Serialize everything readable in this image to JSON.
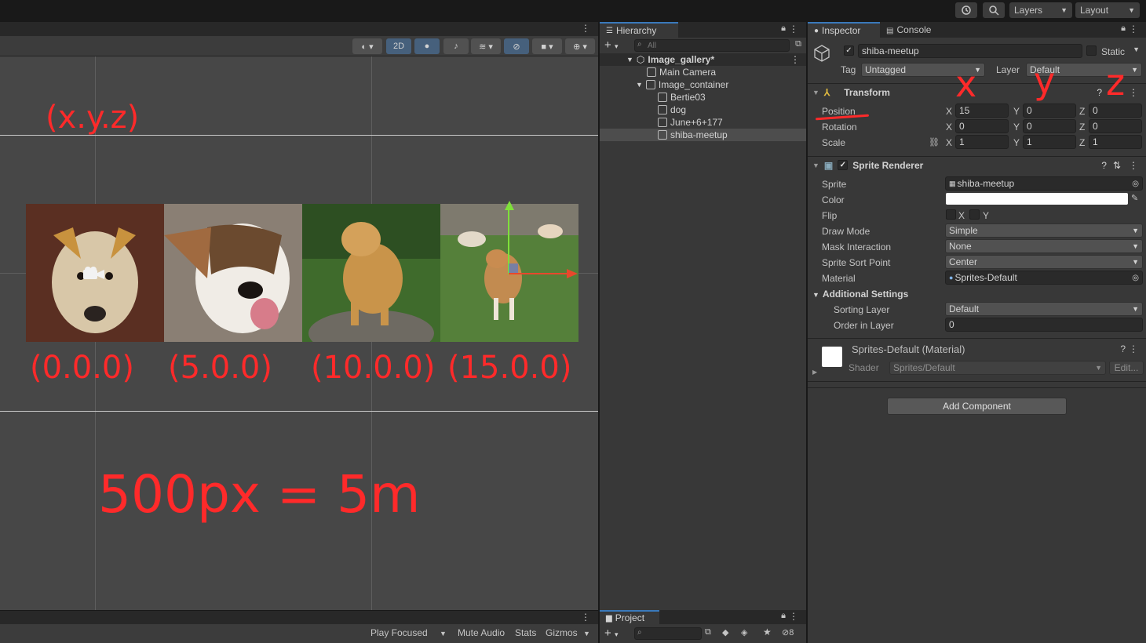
{
  "topbar": {
    "layers_label": "Layers",
    "layout_label": "Layout",
    "history_icon": "history-icon",
    "search_icon": "search-icon"
  },
  "scene": {
    "toolbar": {
      "mode_2d": "2D",
      "gizmo_count": ""
    },
    "annotations": {
      "xyz": "(x.y.z)",
      "pos0": "(0.0.0)",
      "pos1": "(5.0.0)",
      "pos2": "(10.0.0)",
      "pos3": "(15.0.0)",
      "scale_note": "500px = 5m"
    },
    "photos": [
      {
        "name": "Bertie03",
        "bg": "#5a2f22",
        "fg": "#d8c7a8"
      },
      {
        "name": "dog",
        "bg": "#8a7f74",
        "fg": "#6b4a2f"
      },
      {
        "name": "June+6+177",
        "bg": "#3f6b2c",
        "fg": "#c9944a"
      },
      {
        "name": "shiba-meetup",
        "bg": "#55803a",
        "fg": "#c28b50"
      }
    ]
  },
  "game_bar": {
    "play_focused": "Play Focused",
    "mute_audio": "Mute Audio",
    "stats": "Stats",
    "gizmos": "Gizmos"
  },
  "hierarchy": {
    "tab_label": "Hierarchy",
    "search_placeholder": "All",
    "scene_name": "Image_gallery*",
    "items": [
      {
        "label": "Main Camera",
        "depth": 1
      },
      {
        "label": "Image_container",
        "depth": 1
      },
      {
        "label": "Bertie03",
        "depth": 2
      },
      {
        "label": "dog",
        "depth": 2
      },
      {
        "label": "June+6+177",
        "depth": 2
      },
      {
        "label": "shiba-meetup",
        "depth": 2
      }
    ]
  },
  "project": {
    "tab_label": "Project",
    "hidden_count": "8"
  },
  "inspector": {
    "tab_inspector": "Inspector",
    "tab_console": "Console",
    "object_name": "shiba-meetup",
    "static_label": "Static",
    "tag_label": "Tag",
    "tag_value": "Untagged",
    "layer_label": "Layer",
    "layer_value": "Default",
    "transform": {
      "title": "Transform",
      "position_label": "Position",
      "rotation_label": "Rotation",
      "scale_label": "Scale",
      "axis_x": "X",
      "axis_y": "Y",
      "axis_z": "Z",
      "position": [
        "15",
        "0",
        "0"
      ],
      "rotation": [
        "0",
        "0",
        "0"
      ],
      "scale": [
        "1",
        "1",
        "1"
      ]
    },
    "sprite_renderer": {
      "title": "Sprite Renderer",
      "sprite_label": "Sprite",
      "sprite_value": "shiba-meetup",
      "color_label": "Color",
      "color_value": "#ffffff",
      "flip_label": "Flip",
      "flip_x": "X",
      "flip_y": "Y",
      "draw_mode_label": "Draw Mode",
      "draw_mode_value": "Simple",
      "mask_label": "Mask Interaction",
      "mask_value": "None",
      "sort_point_label": "Sprite Sort Point",
      "sort_point_value": "Center",
      "material_label": "Material",
      "material_value": "Sprites-Default",
      "additional_label": "Additional Settings",
      "sorting_layer_label": "Sorting Layer",
      "sorting_layer_value": "Default",
      "order_label": "Order in Layer",
      "order_value": "0"
    },
    "material_block": {
      "title": "Sprites-Default (Material)",
      "shader_label": "Shader",
      "shader_value": "Sprites/Default",
      "edit_label": "Edit..."
    },
    "add_component": "Add Component",
    "handwriting": {
      "x": "x",
      "y": "y",
      "z": "z"
    }
  }
}
